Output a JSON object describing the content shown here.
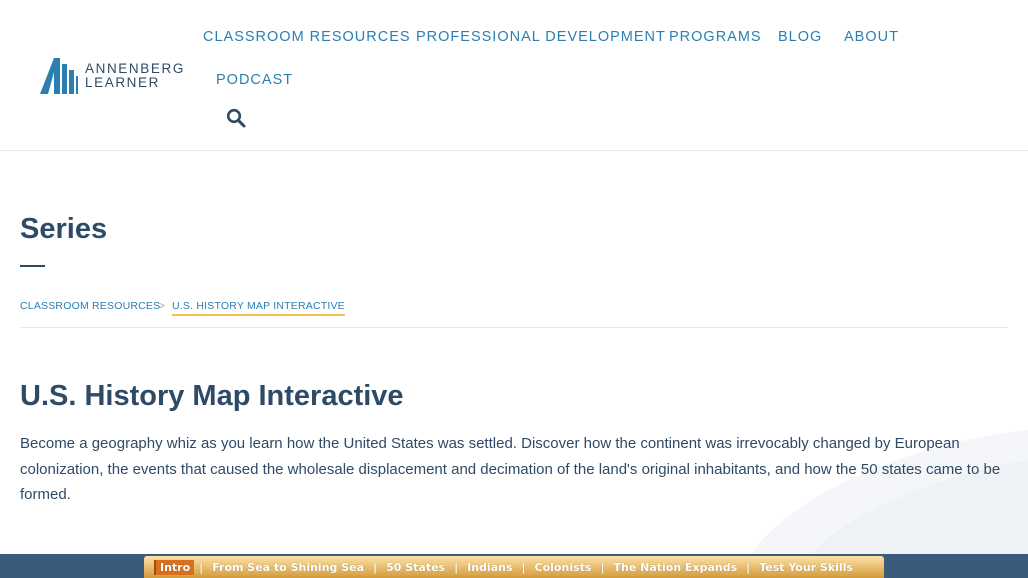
{
  "header": {
    "logo": {
      "line1": "ANNENBERG",
      "line2": "LEARNER"
    },
    "nav": [
      {
        "label": "CLASSROOM RESOURCES"
      },
      {
        "label": "PROFESSIONAL DEVELOPMENT"
      },
      {
        "label": "PROGRAMS"
      },
      {
        "label": "BLOG"
      },
      {
        "label": "ABOUT"
      },
      {
        "label": "PODCAST"
      }
    ],
    "search_icon": "search-icon"
  },
  "page": {
    "title": "Series",
    "breadcrumb": {
      "items": [
        {
          "label": "CLASSROOM RESOURCES"
        }
      ],
      "separator": ">",
      "current": "U.S. HISTORY MAP INTERACTIVE"
    },
    "heading": "U.S. History Map Interactive",
    "description": "Become a geography whiz as you learn how the United States was settled. Discover how the continent was irrevocably changed by European colonization, the events that caused the wholesale displacement and decimation of the land's original inhabitants, and how the 50 states came to be formed."
  },
  "interactive": {
    "separator": "|",
    "items": [
      {
        "label": "Intro",
        "active": true
      },
      {
        "label": "From Sea to Shining Sea"
      },
      {
        "label": "50 States"
      },
      {
        "label": "Indians"
      },
      {
        "label": "Colonists"
      },
      {
        "label": "The Nation Expands"
      },
      {
        "label": "Test Your Skills"
      }
    ]
  },
  "colors": {
    "brand_navy": "#2e4a66",
    "link_blue": "#2b7fb0",
    "accent_yellow": "#f2c14e",
    "band_blue": "#3b5b7d",
    "interactive_orange": "#d7701f"
  }
}
